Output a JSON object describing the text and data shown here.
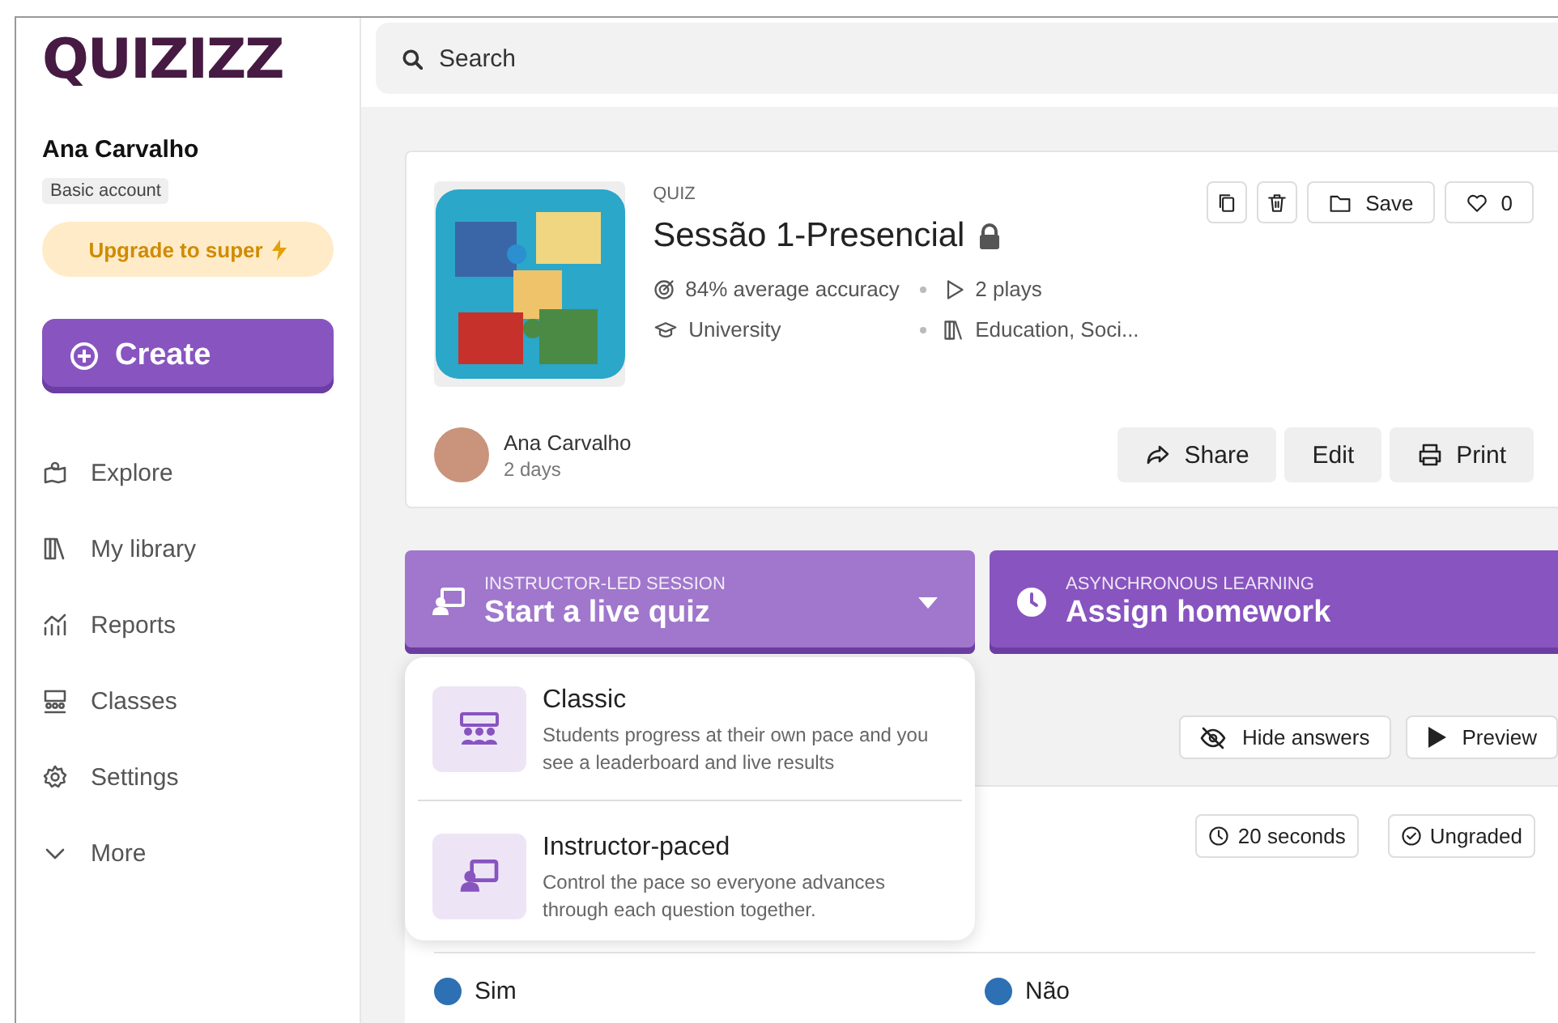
{
  "logo": "QUIZIZZ",
  "user": {
    "name": "Ana Carvalho",
    "plan": "Basic account"
  },
  "upgrade_button": "Upgrade to super",
  "create_button": "Create",
  "nav": [
    {
      "kind": "explore",
      "label": "Explore"
    },
    {
      "kind": "library",
      "label": "My library"
    },
    {
      "kind": "reports",
      "label": "Reports"
    },
    {
      "kind": "classes",
      "label": "Classes"
    },
    {
      "kind": "settings",
      "label": "Settings"
    },
    {
      "kind": "more",
      "label": "More"
    }
  ],
  "search": {
    "placeholder": "Search"
  },
  "quiz": {
    "type_label": "QUIZ",
    "title": "Sessão 1-Presencial",
    "locked": true,
    "stats": [
      {
        "kind": "accuracy",
        "text": "84% average accuracy"
      },
      {
        "kind": "plays",
        "text": "2 plays"
      },
      {
        "kind": "grade",
        "text": "University"
      },
      {
        "kind": "subject",
        "text": "Education, Soci..."
      }
    ],
    "save_button": "Save",
    "likes": "0",
    "author": {
      "name": "Ana Carvalho",
      "time": "2 days"
    },
    "actions": [
      {
        "kind": "share",
        "label": "Share"
      },
      {
        "kind": "edit",
        "label": "Edit"
      },
      {
        "kind": "print",
        "label": "Print"
      }
    ]
  },
  "sessions": [
    {
      "kind": "live",
      "caption": "INSTRUCTOR-LED SESSION",
      "title": "Start a live quiz",
      "expanded": true
    },
    {
      "kind": "homework",
      "caption": "ASYNCHRONOUS LEARNING",
      "title": "Assign homework"
    }
  ],
  "live_menu": [
    {
      "kind": "classic",
      "title": "Classic",
      "description": "Students progress at their own pace and you see a leaderboard and live results"
    },
    {
      "kind": "paced",
      "title": "Instructor-paced",
      "description": "Control the pace so everyone advances through each question together."
    }
  ],
  "toolbar": [
    {
      "kind": "hide",
      "label": "Hide answers"
    },
    {
      "kind": "preview",
      "label": "Preview"
    }
  ],
  "question": {
    "time": "20 seconds",
    "grading": "Ungraded",
    "choices": [
      "Sim",
      "Não"
    ]
  }
}
